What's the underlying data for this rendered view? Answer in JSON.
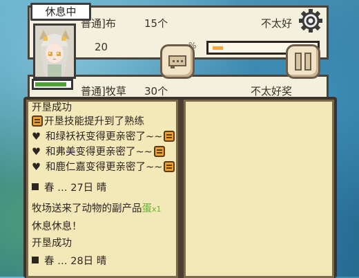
{
  "avatar": {
    "status": "休息中",
    "hp_fraction": 0.9
  },
  "cards": [
    {
      "title": "普通]布",
      "count": "15个",
      "mood": "不太好",
      "num": "20",
      "slash": "%",
      "progress": 0.1
    },
    {
      "title": "普通]牧草",
      "count": "30个",
      "mood": "不太好奖"
    }
  ],
  "colors": {
    "accent": "#f4a93a",
    "hp": "#4da236",
    "page": "#f3e8b8"
  },
  "icons": {
    "settings": "gear-icon",
    "chat": "chat-bubble-icon",
    "pause": "pause-icon"
  },
  "log": {
    "lines": [
      {
        "text": "开垦成功"
      },
      {
        "prefix_icon": "emoji",
        "text": "开垦技能提升到了熟练"
      },
      {
        "prefix_icon": "heart",
        "text": "和绿袄袄变得更亲密了~~"
      },
      {
        "prefix_icon": "heart",
        "text": "和弗美变得更亲密了~~"
      },
      {
        "prefix_icon": "heart",
        "text": "和鹿仁嘉变得更亲密了~~"
      },
      {
        "prefix_icon": "square",
        "text": "春 … 27日 晴"
      },
      {
        "text": "牧场送来了动物的副产品",
        "extra": "蛋",
        "extra_count": "x1"
      },
      {
        "text": "休息休息！"
      },
      {
        "text": "开垦成功"
      },
      {
        "prefix_icon": "square",
        "text": "春 … 28日 晴"
      }
    ],
    "heart_symbol": "♥"
  }
}
